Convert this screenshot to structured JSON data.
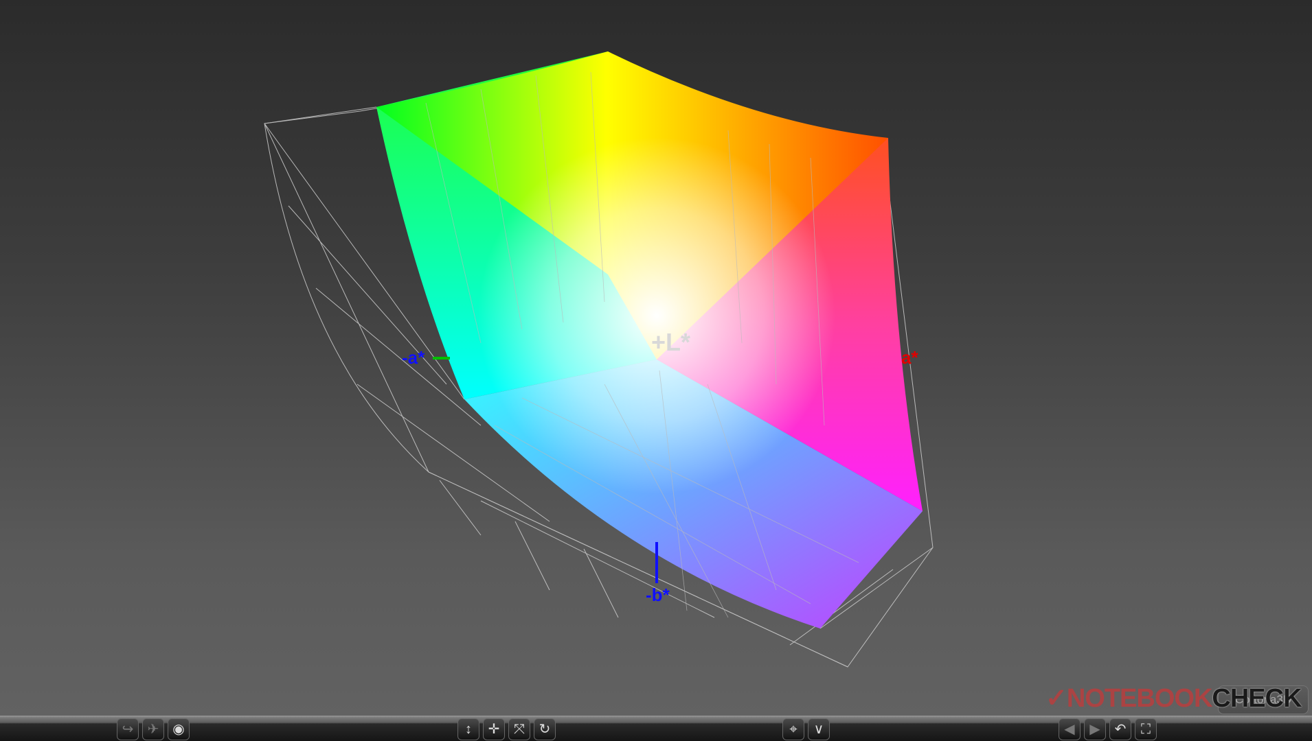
{
  "axes": {
    "l_plus": "+L*",
    "a_plus": "a*",
    "a_minus": "-a*",
    "b_minus": "-b*"
  },
  "watermark": {
    "brand_a": "NOTEBOOK",
    "brand_b": "CHECK"
  },
  "viewer": {
    "brand": "Cortona3D"
  },
  "toolbar": {
    "left": [
      {
        "icon": "walk-icon"
      },
      {
        "icon": "fly-icon"
      },
      {
        "icon": "study-eye-icon"
      }
    ],
    "middle": [
      {
        "icon": "slide-icon"
      },
      {
        "icon": "pan-icon"
      },
      {
        "icon": "tilt-icon"
      },
      {
        "icon": "rotate-icon"
      }
    ],
    "center": [
      {
        "icon": "goto-icon"
      },
      {
        "icon": "align-icon"
      }
    ],
    "right": [
      {
        "icon": "prev-viewpoint-icon"
      },
      {
        "icon": "next-viewpoint-icon"
      },
      {
        "icon": "restore-icon"
      },
      {
        "icon": "fit-icon"
      }
    ]
  },
  "colors": {
    "a_axis": "#e00000",
    "b_axis": "#1010ff",
    "green_axis": "#00c000"
  }
}
